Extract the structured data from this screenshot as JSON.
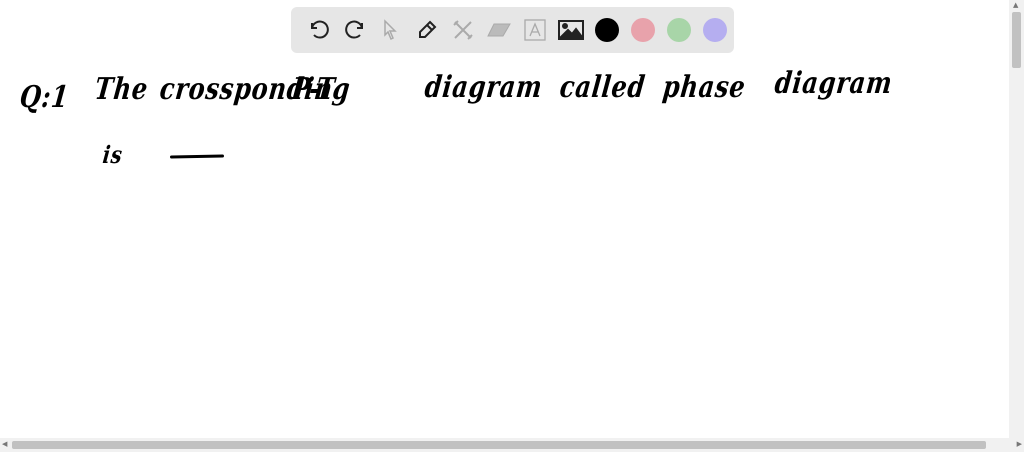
{
  "toolbar": {
    "tools": [
      "undo-icon",
      "redo-icon",
      "select-icon",
      "pen-icon",
      "tools-icon",
      "eraser-icon",
      "text-icon",
      "image-icon"
    ],
    "colors": [
      "#000000",
      "#e8a2ab",
      "#a8d5a8",
      "#b5aef0"
    ]
  },
  "canvas": {
    "line1": {
      "words": [
        "Q:1",
        "The",
        "crossponding",
        "P-T",
        "diagram",
        "called",
        "phase",
        "diagram"
      ]
    },
    "line2": {
      "words": [
        "is"
      ]
    }
  }
}
